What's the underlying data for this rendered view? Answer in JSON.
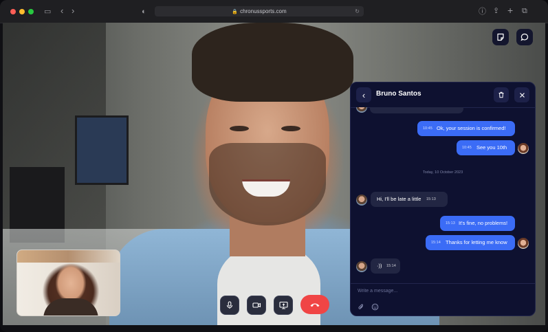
{
  "browser": {
    "url": "chronussports.com",
    "icons": [
      "sidebar-icon",
      "back-icon",
      "forward-icon",
      "privacy-shield-icon",
      "reload-icon",
      "download-icon",
      "share-icon",
      "new-tab-icon",
      "tabs-overview-icon"
    ]
  },
  "call": {
    "top_controls": [
      "notes-icon",
      "chat-bubble-icon"
    ],
    "bottom_controls": [
      "microphone-icon",
      "camera-icon",
      "screen-share-icon",
      "end-call-icon"
    ],
    "end_call_color": "#f04545"
  },
  "chat": {
    "contact_name": "Bruno Santos",
    "date_separator": "Today, 10 October 2023",
    "messages": [
      {
        "direction": "out",
        "time": "10:45",
        "text": "Ok, your session is confirmed!"
      },
      {
        "direction": "out",
        "time": "10:45",
        "text": "See you 10th"
      },
      {
        "direction": "in",
        "time": "15:13",
        "text": "Hi, I'll be late a little"
      },
      {
        "direction": "out",
        "time": "15:13",
        "text": "It's fine, no problems!"
      },
      {
        "direction": "out",
        "time": "15:14",
        "text": "Thanks for letting me know"
      },
      {
        "direction": "in",
        "time": "15:14",
        "text": "·))"
      }
    ],
    "composer_placeholder": "Write a message...",
    "accent_color": "#3b6cf6"
  }
}
